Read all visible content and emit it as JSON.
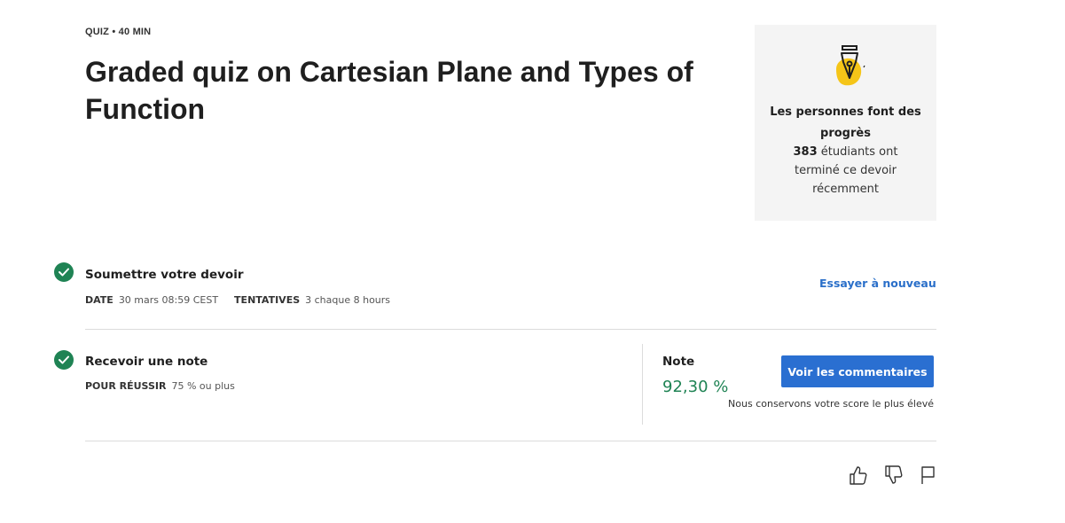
{
  "header": {
    "type": "QUIZ",
    "separator": "•",
    "duration": "40  MIN",
    "title": "Graded quiz on Cartesian Plane and Types of Function"
  },
  "progress_card": {
    "icon": "fountain-pen-icon",
    "heading": "Les personnes font des progrès",
    "count": "383",
    "body": " étudiants ont terminé ce devoir récemment"
  },
  "submit_row": {
    "title": "Soumettre votre devoir",
    "date_label": "DATE",
    "date_value": "30 mars 08:59 CEST",
    "attempts_label": "TENTATIVES",
    "attempts_value": "3 chaque 8  hours",
    "retry_label": "Essayer à nouveau"
  },
  "grade_row": {
    "title": "Recevoir une note",
    "pass_label": "POUR RÉUSSIR",
    "pass_value": "75 % ou plus",
    "note_label": "Note",
    "note_value": "92,30 %",
    "feedback_button": "Voir les commentaires",
    "keep_note": "Nous conservons votre score le plus élevé"
  },
  "feedback_icons": [
    "thumbs-up-icon",
    "thumbs-down-icon",
    "flag-icon"
  ],
  "colors": {
    "success": "#1f8354",
    "link": "#2a6fc9",
    "primary_button": "#2a6fd1",
    "card_bg": "#f4f4f4",
    "icon_yellow": "#f5c518"
  }
}
